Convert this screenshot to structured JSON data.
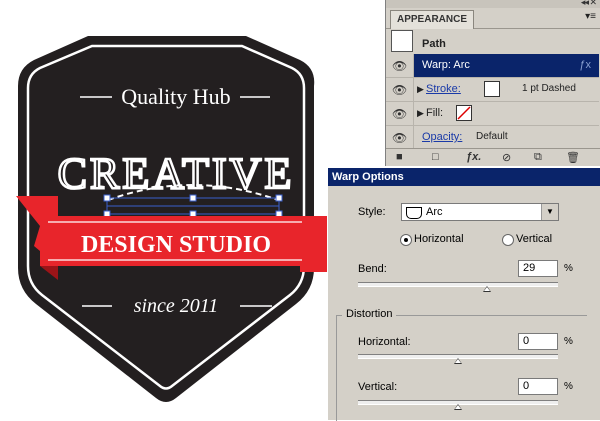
{
  "artwork": {
    "top_text": "Quality Hub",
    "main_text": "CREATIVE",
    "ribbon_text": "DESIGN STUDIO",
    "bottom_text": "since 2011",
    "colors": {
      "badge": "#231f20",
      "ribbon": "#e8252b",
      "ribbon_dark": "#9c1418",
      "text": "#ffffff",
      "selection": "#3a5fcd"
    }
  },
  "appearance_panel": {
    "tab_label": "APPEARANCE",
    "path_label": "Path",
    "rows": [
      {
        "name": "warp",
        "label": "Warp: Arc",
        "fx_icon": "fx-icon"
      },
      {
        "name": "stroke",
        "label": "Stroke:",
        "value": "1 pt Dashed"
      },
      {
        "name": "fill",
        "label": "Fill:"
      },
      {
        "name": "opacity",
        "label": "Opacity:",
        "value": "Default"
      }
    ],
    "bottom_icons": [
      "square-icon",
      "new-layer-icon",
      "fx-icon",
      "clear-icon",
      "duplicate-icon",
      "trash-icon"
    ]
  },
  "warp_options": {
    "title": "Warp Options",
    "style_label": "Style:",
    "style_value": "Arc",
    "horizontal_radio": "Horizontal",
    "vertical_radio": "Vertical",
    "orientation_selected": "Horizontal",
    "bend_label": "Bend:",
    "bend_value": "29",
    "distortion_label": "Distortion",
    "horizontal_label": "Horizontal:",
    "horizontal_value": "0",
    "vertical_label": "Vertical:",
    "vertical_value": "0",
    "percent": "%"
  }
}
